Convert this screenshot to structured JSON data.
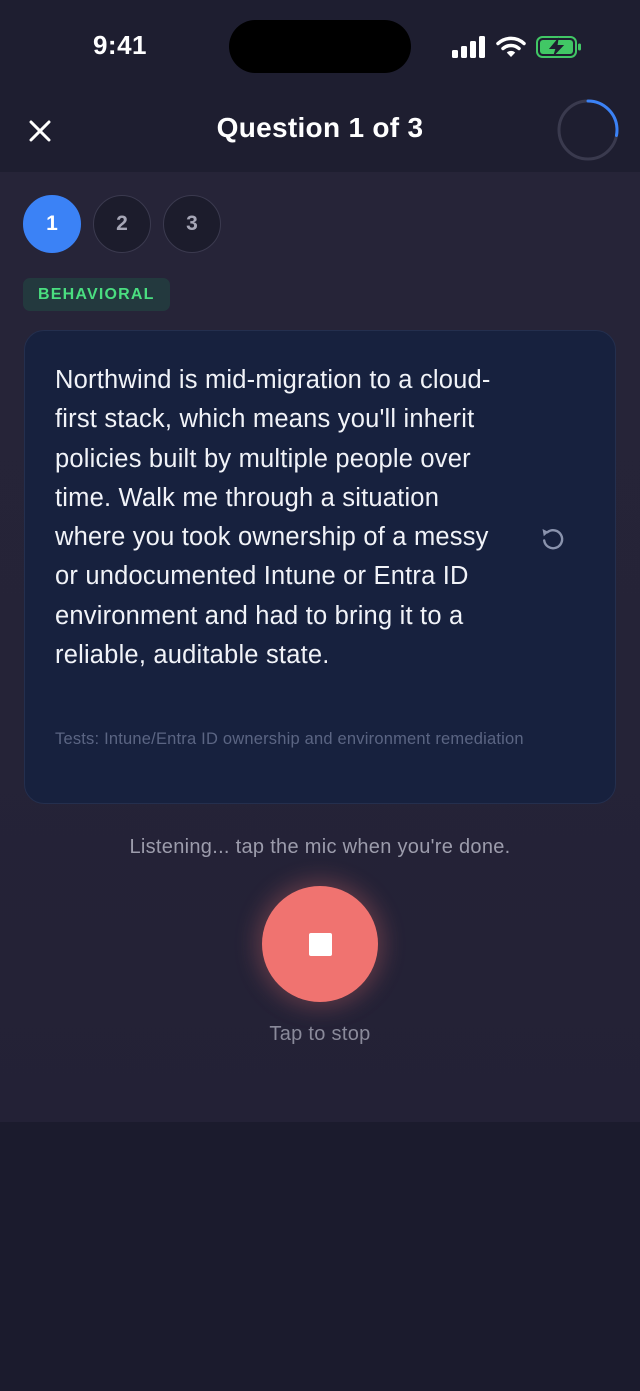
{
  "status_bar": {
    "time": "9:41"
  },
  "header": {
    "title": "Question 1 of 3",
    "close_icon": "close-icon",
    "timer_progress": 0.28
  },
  "steps": [
    {
      "label": "1",
      "active": true
    },
    {
      "label": "2",
      "active": false
    },
    {
      "label": "3",
      "active": false
    }
  ],
  "category_badge": "BEHAVIORAL",
  "question": {
    "text": "Northwind is mid-migration to a cloud-first stack, which means you'll inherit policies built by multiple people over time. Walk me through a situation where you took ownership of a messy or undocumented Intune or Entra ID environment and had to bring it to a reliable, auditable state.",
    "tests": "Tests: Intune/Entra ID ownership and environment remediation",
    "replay_icon": "replay-icon"
  },
  "recording": {
    "status": "Listening... tap the mic when you're done.",
    "action_label": "Tap to stop",
    "button_icon": "stop-icon"
  },
  "colors": {
    "accent": "#3b82f6",
    "record": "#f07370",
    "badge_text": "#4ade80",
    "card_bg": "#17213e"
  }
}
